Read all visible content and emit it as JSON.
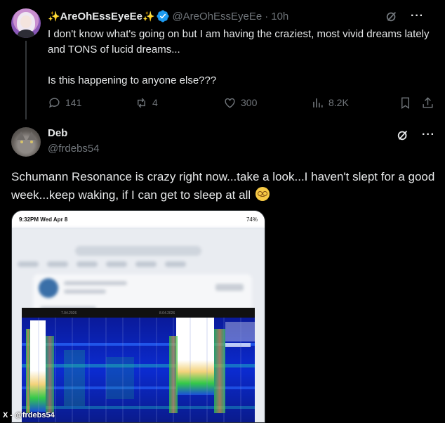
{
  "tweet1": {
    "display_name": "AreOhEssEyeEe",
    "handle": "@AreOhEssEyeEe",
    "separator": "·",
    "time": "10h",
    "text_line1": "I don't know what's going on but I am having the craziest, most vivid dreams lately and TONS of lucid dreams...",
    "text_line2": "Is this happening to anyone else???",
    "replies": "141",
    "reposts": "4",
    "likes": "300",
    "views": "8.2K"
  },
  "tweet2": {
    "display_name": "Deb",
    "handle": "@frdebs54",
    "text": "Schumann Resonance is crazy right now...take a look...I haven't slept for a good week...keep waking, if I can get to sleep at all",
    "emoji": "woozy-face-emoji"
  },
  "media": {
    "status_time": "9:32PM  Wed Apr 8",
    "status_right": "74%"
  },
  "watermark": "X - @frdebs54",
  "colors": {
    "background": "#000000",
    "text_primary": "#e7e9ea",
    "text_secondary": "#71767b",
    "verified": "#1d9bf0",
    "divider": "#333639"
  }
}
